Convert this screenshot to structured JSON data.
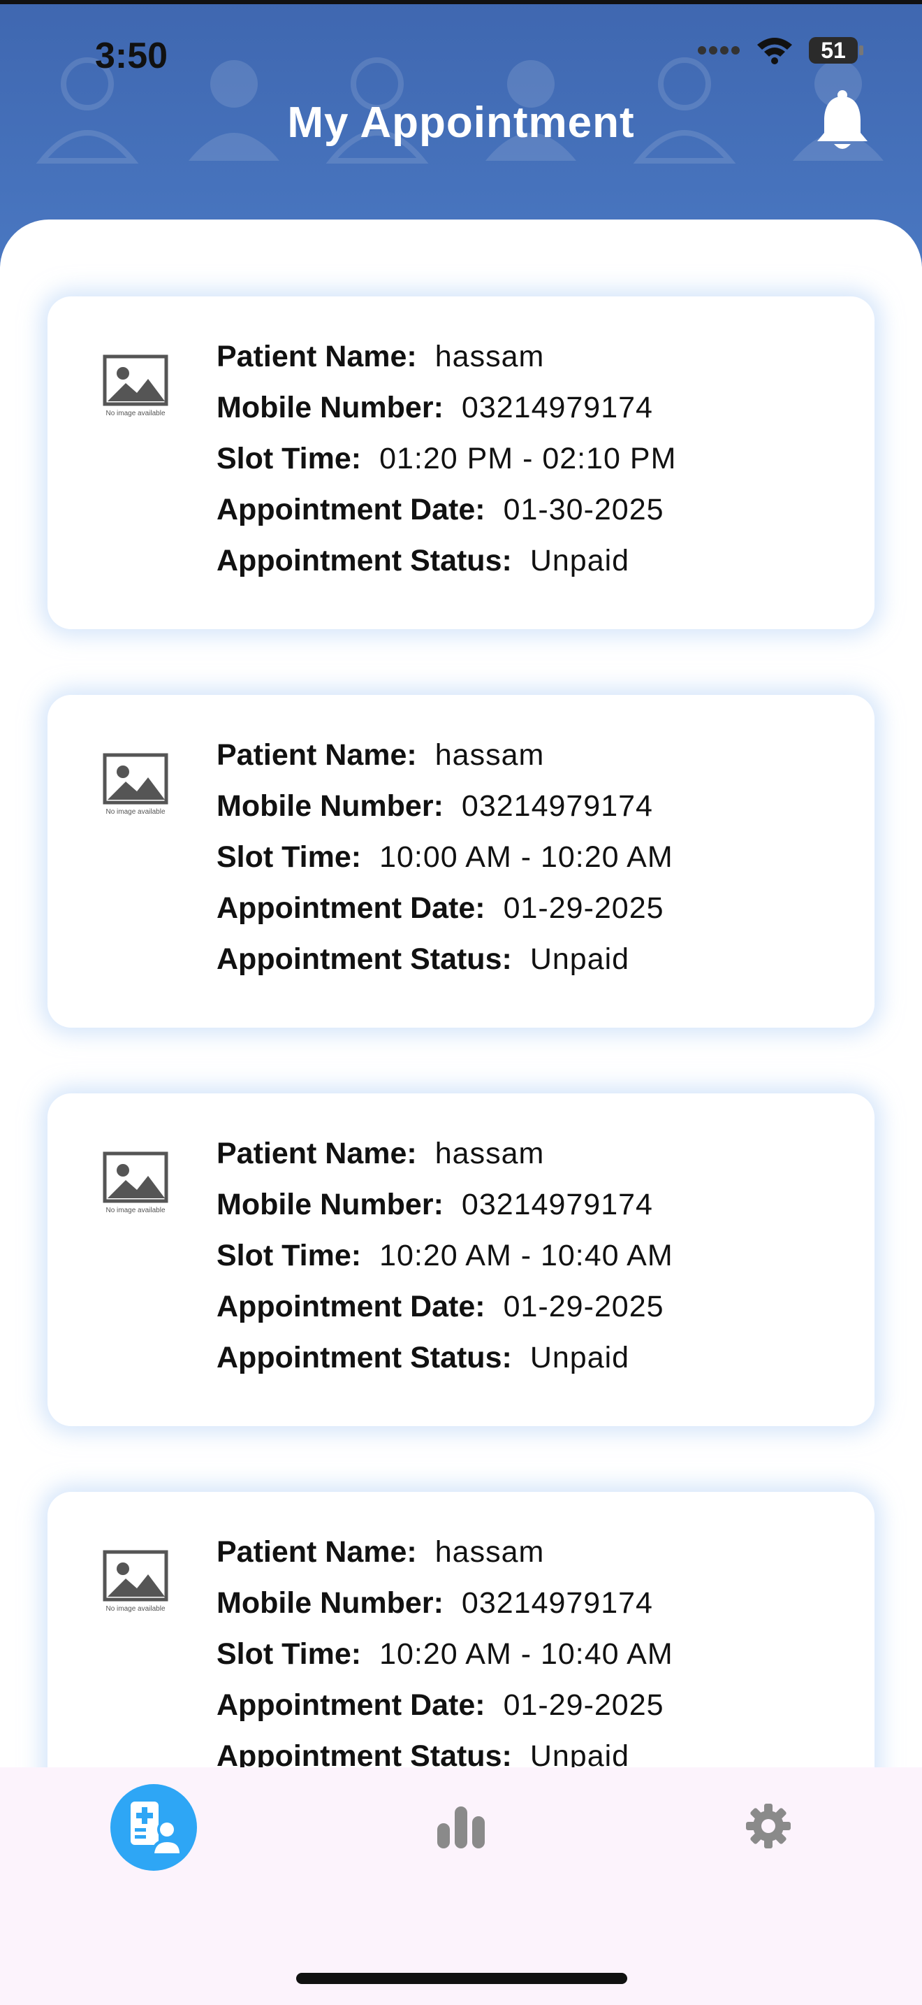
{
  "status_bar": {
    "time": "3:50",
    "battery": "51"
  },
  "header": {
    "title": "My Appointment"
  },
  "labels": {
    "patient_name": "Patient Name:",
    "mobile_number": "Mobile Number:",
    "slot_time": "Slot Time:",
    "appointment_date": "Appointment Date:",
    "appointment_status": "Appointment Status:",
    "no_image": "No image available"
  },
  "appointments": [
    {
      "patient_name": "hassam",
      "mobile_number": "03214979174",
      "slot_time": "01:20 PM - 02:10 PM",
      "appointment_date": "01-30-2025",
      "status": "Unpaid"
    },
    {
      "patient_name": "hassam",
      "mobile_number": "03214979174",
      "slot_time": "10:00 AM - 10:20 AM",
      "appointment_date": "01-29-2025",
      "status": "Unpaid"
    },
    {
      "patient_name": "hassam",
      "mobile_number": "03214979174",
      "slot_time": "10:20 AM - 10:40 AM",
      "appointment_date": "01-29-2025",
      "status": "Unpaid"
    },
    {
      "patient_name": "hassam",
      "mobile_number": "03214979174",
      "slot_time": "10:20 AM - 10:40 AM",
      "appointment_date": "01-29-2025",
      "status": "Unpaid"
    }
  ],
  "bottom_nav": {
    "items": [
      {
        "icon": "patient-appointment-icon",
        "active": true
      },
      {
        "icon": "bar-chart-icon",
        "active": false
      },
      {
        "icon": "gear-icon",
        "active": false
      }
    ]
  },
  "colors": {
    "header": "#4a78c2",
    "accent": "#2ea6f5",
    "nav_bg": "#fcf3fc"
  }
}
